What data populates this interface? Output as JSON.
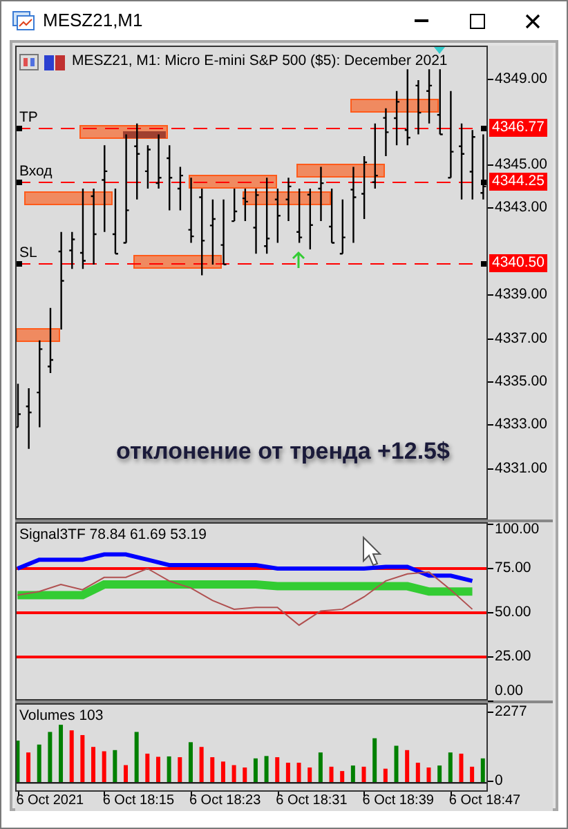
{
  "window": {
    "title": "MESZ21,M1"
  },
  "chart": {
    "title": "MESZ21, M1:  Micro E-mini S&P 500 ($5): December 2021",
    "price_axis": [
      "4349.00",
      "4345.00",
      "4343.00",
      "4339.00",
      "4337.00",
      "4335.00",
      "4333.00",
      "4331.00"
    ],
    "levels": [
      {
        "label": "TP",
        "price_tag": "4346.77"
      },
      {
        "label": "Вход",
        "price_tag": "4344.25"
      },
      {
        "label": "SL",
        "price_tag": "4340.50"
      }
    ],
    "overlay_text": "отклонение от тренда +12.5$"
  },
  "indicator": {
    "chart_data": {
      "type": "line",
      "title": "Signal3TF 78.84 61.69 53.19",
      "series": [
        {
          "color": "#0000ff",
          "values": [
            75,
            80,
            80,
            80,
            83,
            83,
            80,
            77,
            77,
            77,
            77,
            77,
            75,
            75,
            75,
            75,
            75,
            76,
            76,
            71,
            71,
            68
          ]
        },
        {
          "color": "#33cc33",
          "values": [
            60,
            60,
            60,
            60,
            66,
            66,
            66,
            66,
            66,
            66,
            66,
            66,
            65,
            65,
            65,
            65,
            65,
            65,
            65,
            62,
            62,
            62
          ]
        },
        {
          "color": "#b05050",
          "values": [
            60,
            62,
            66,
            63,
            70,
            70,
            75,
            68,
            64,
            57,
            52,
            53,
            53,
            43,
            51,
            52,
            59,
            68,
            72,
            73,
            63,
            52
          ]
        }
      ],
      "ylim": [
        0,
        100
      ],
      "grid": true,
      "yticks": [
        {
          "value": 100,
          "label": "100.00"
        },
        {
          "value": 75,
          "label": "75.00"
        },
        {
          "value": 50,
          "label": "50.00"
        },
        {
          "value": 25,
          "label": "25.00"
        },
        {
          "value": 0,
          "label": "0.00"
        }
      ]
    }
  },
  "volumes": {
    "chart_data": {
      "type": "bar",
      "title": "Volumes 103",
      "series": [
        {
          "color": "#008000",
          "values": [
            1366,
            null,
            1236,
            1652,
            1887,
            null,
            null,
            null,
            null,
            1054,
            null,
            1652,
            null,
            null,
            846,
            null,
            1314,
            null,
            null,
            null,
            null,
            null,
            781,
            859,
            null,
            null,
            null,
            null,
            976,
            null,
            null,
            546,
            null,
            1444,
            null,
            1197,
            null,
            null,
            null,
            546,
            976,
            null,
            null,
            781
          ]
        },
        {
          "color": "#ff0000",
          "values": [
            null,
            976,
            null,
            null,
            null,
            1704,
            1548,
            1158,
            1015,
            null,
            559,
            null,
            937,
            833,
            null,
            820,
            null,
            1158,
            820,
            677,
            559,
            481,
            null,
            null,
            820,
            638,
            638,
            481,
            null,
            507,
            364,
            null,
            507,
            null,
            442,
            null,
            1054,
            638,
            481,
            null,
            null,
            937,
            507,
            null
          ]
        }
      ],
      "ylim": [
        -270,
        2550
      ],
      "yticks": [
        {
          "value": 2277,
          "label": "2277"
        },
        {
          "value": 0,
          "label": "0"
        }
      ]
    },
    "time_axis": [
      "6 Oct 2021",
      "6 Oct 18:15",
      "6 Oct 18:23",
      "6 Oct 18:31",
      "6 Oct 18:39",
      "6 Oct 18:47"
    ]
  }
}
